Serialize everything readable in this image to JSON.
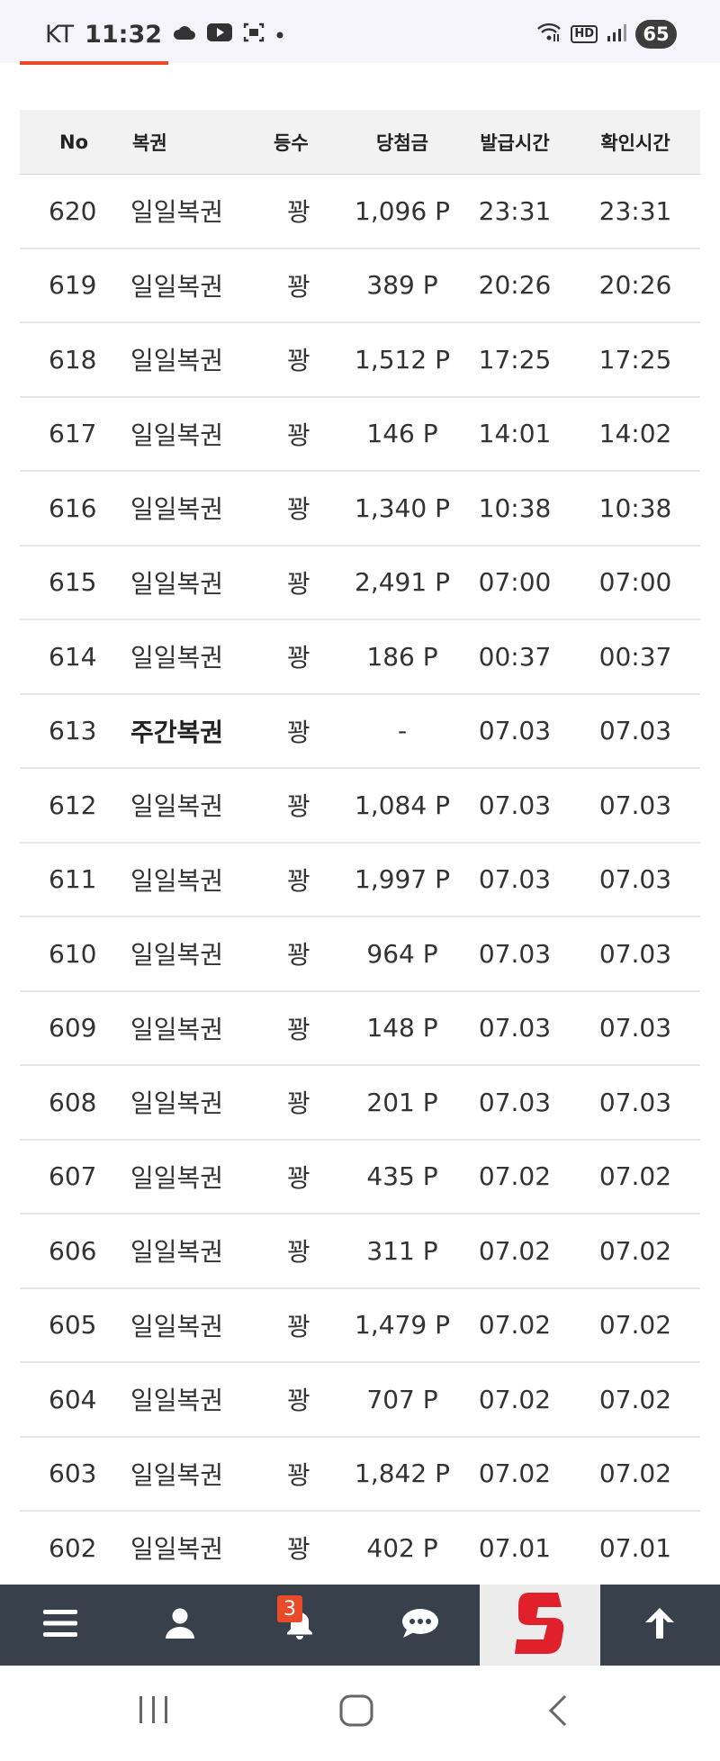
{
  "status_bar": {
    "carrier": "KT",
    "time": "11:32",
    "battery": "65",
    "hd": "HD",
    "icons": [
      "cloud-icon",
      "youtube-icon",
      "screenshot-icon",
      "dot-icon",
      "wifi-icon",
      "hd-icon",
      "signal-icon"
    ]
  },
  "table": {
    "headers": {
      "no": "No",
      "name": "복권",
      "rank": "등수",
      "prize": "당첨금",
      "issued": "발급시간",
      "checked": "확인시간"
    },
    "rows": [
      {
        "no": "620",
        "name": "일일복권",
        "rank": "꽝",
        "prize": "1,096 P",
        "issued": "23:31",
        "checked": "23:31"
      },
      {
        "no": "619",
        "name": "일일복권",
        "rank": "꽝",
        "prize": "389 P",
        "issued": "20:26",
        "checked": "20:26"
      },
      {
        "no": "618",
        "name": "일일복권",
        "rank": "꽝",
        "prize": "1,512 P",
        "issued": "17:25",
        "checked": "17:25"
      },
      {
        "no": "617",
        "name": "일일복권",
        "rank": "꽝",
        "prize": "146 P",
        "issued": "14:01",
        "checked": "14:02"
      },
      {
        "no": "616",
        "name": "일일복권",
        "rank": "꽝",
        "prize": "1,340 P",
        "issued": "10:38",
        "checked": "10:38"
      },
      {
        "no": "615",
        "name": "일일복권",
        "rank": "꽝",
        "prize": "2,491 P",
        "issued": "07:00",
        "checked": "07:00"
      },
      {
        "no": "614",
        "name": "일일복권",
        "rank": "꽝",
        "prize": "186 P",
        "issued": "00:37",
        "checked": "00:37"
      },
      {
        "no": "613",
        "name": "주간복권",
        "rank": "꽝",
        "prize": "-",
        "issued": "07.03",
        "checked": "07.03"
      },
      {
        "no": "612",
        "name": "일일복권",
        "rank": "꽝",
        "prize": "1,084 P",
        "issued": "07.03",
        "checked": "07.03"
      },
      {
        "no": "611",
        "name": "일일복권",
        "rank": "꽝",
        "prize": "1,997 P",
        "issued": "07.03",
        "checked": "07.03"
      },
      {
        "no": "610",
        "name": "일일복권",
        "rank": "꽝",
        "prize": "964 P",
        "issued": "07.03",
        "checked": "07.03"
      },
      {
        "no": "609",
        "name": "일일복권",
        "rank": "꽝",
        "prize": "148 P",
        "issued": "07.03",
        "checked": "07.03"
      },
      {
        "no": "608",
        "name": "일일복권",
        "rank": "꽝",
        "prize": "201 P",
        "issued": "07.03",
        "checked": "07.03"
      },
      {
        "no": "607",
        "name": "일일복권",
        "rank": "꽝",
        "prize": "435 P",
        "issued": "07.02",
        "checked": "07.02"
      },
      {
        "no": "606",
        "name": "일일복권",
        "rank": "꽝",
        "prize": "311 P",
        "issued": "07.02",
        "checked": "07.02"
      },
      {
        "no": "605",
        "name": "일일복권",
        "rank": "꽝",
        "prize": "1,479 P",
        "issued": "07.02",
        "checked": "07.02"
      },
      {
        "no": "604",
        "name": "일일복권",
        "rank": "꽝",
        "prize": "707 P",
        "issued": "07.02",
        "checked": "07.02"
      },
      {
        "no": "603",
        "name": "일일복권",
        "rank": "꽝",
        "prize": "1,842 P",
        "issued": "07.02",
        "checked": "07.02"
      },
      {
        "no": "602",
        "name": "일일복권",
        "rank": "꽝",
        "prize": "402 P",
        "issued": "07.01",
        "checked": "07.01"
      }
    ]
  },
  "bottom_nav": {
    "items": [
      "menu-icon",
      "user-icon",
      "bell-icon",
      "chat-icon",
      "site-logo",
      "arrow-up-icon"
    ],
    "notification_count": "3",
    "bg_color": "#38414b",
    "logo_color": "#e0202a"
  },
  "system_nav": {
    "items": [
      "recent-apps-icon",
      "home-icon",
      "back-icon"
    ]
  },
  "colors": {
    "accent": "#e94b2a",
    "header_bg": "#f2f2f2",
    "status_bg": "#f5f4fa"
  }
}
